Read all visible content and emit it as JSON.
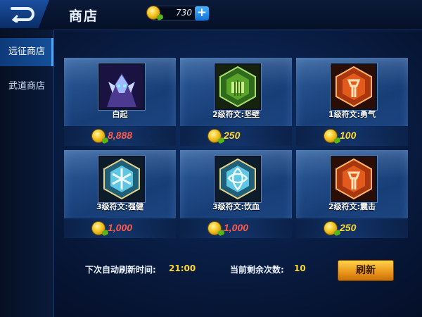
{
  "header": {
    "title": "商店",
    "coins": "730",
    "back_icon": "back-arrow-icon",
    "add_icon": "plus-icon"
  },
  "sidebar": {
    "tabs": [
      {
        "label": "远征商店",
        "active": true
      },
      {
        "label": "武道商店",
        "active": false
      }
    ]
  },
  "items": [
    {
      "name": "白起",
      "price": "8,888",
      "price_color": "#ff5a4a",
      "icon": "hero-baiqi-icon"
    },
    {
      "name": "2级符文:坚壁",
      "price": "250",
      "price_color": "#ffd92a",
      "icon": "green-rune-icon"
    },
    {
      "name": "1级符文:勇气",
      "price": "100",
      "price_color": "#ffd92a",
      "icon": "red-rune-icon"
    },
    {
      "name": "3级符文:强健",
      "price": "1,000",
      "price_color": "#ff5a4a",
      "icon": "blue-rune-icon"
    },
    {
      "name": "3级符文:饮血",
      "price": "1,000",
      "price_color": "#ff5a4a",
      "icon": "blue-rune-icon"
    },
    {
      "name": "2级符文:震击",
      "price": "250",
      "price_color": "#ffd92a",
      "icon": "red-rune-icon"
    }
  ],
  "footer": {
    "refresh_time_label": "下次自动刷新时间:",
    "refresh_time": "21:00",
    "remaining_label": "当前剩余次数:",
    "remaining": "10",
    "refresh_button": "刷新"
  }
}
